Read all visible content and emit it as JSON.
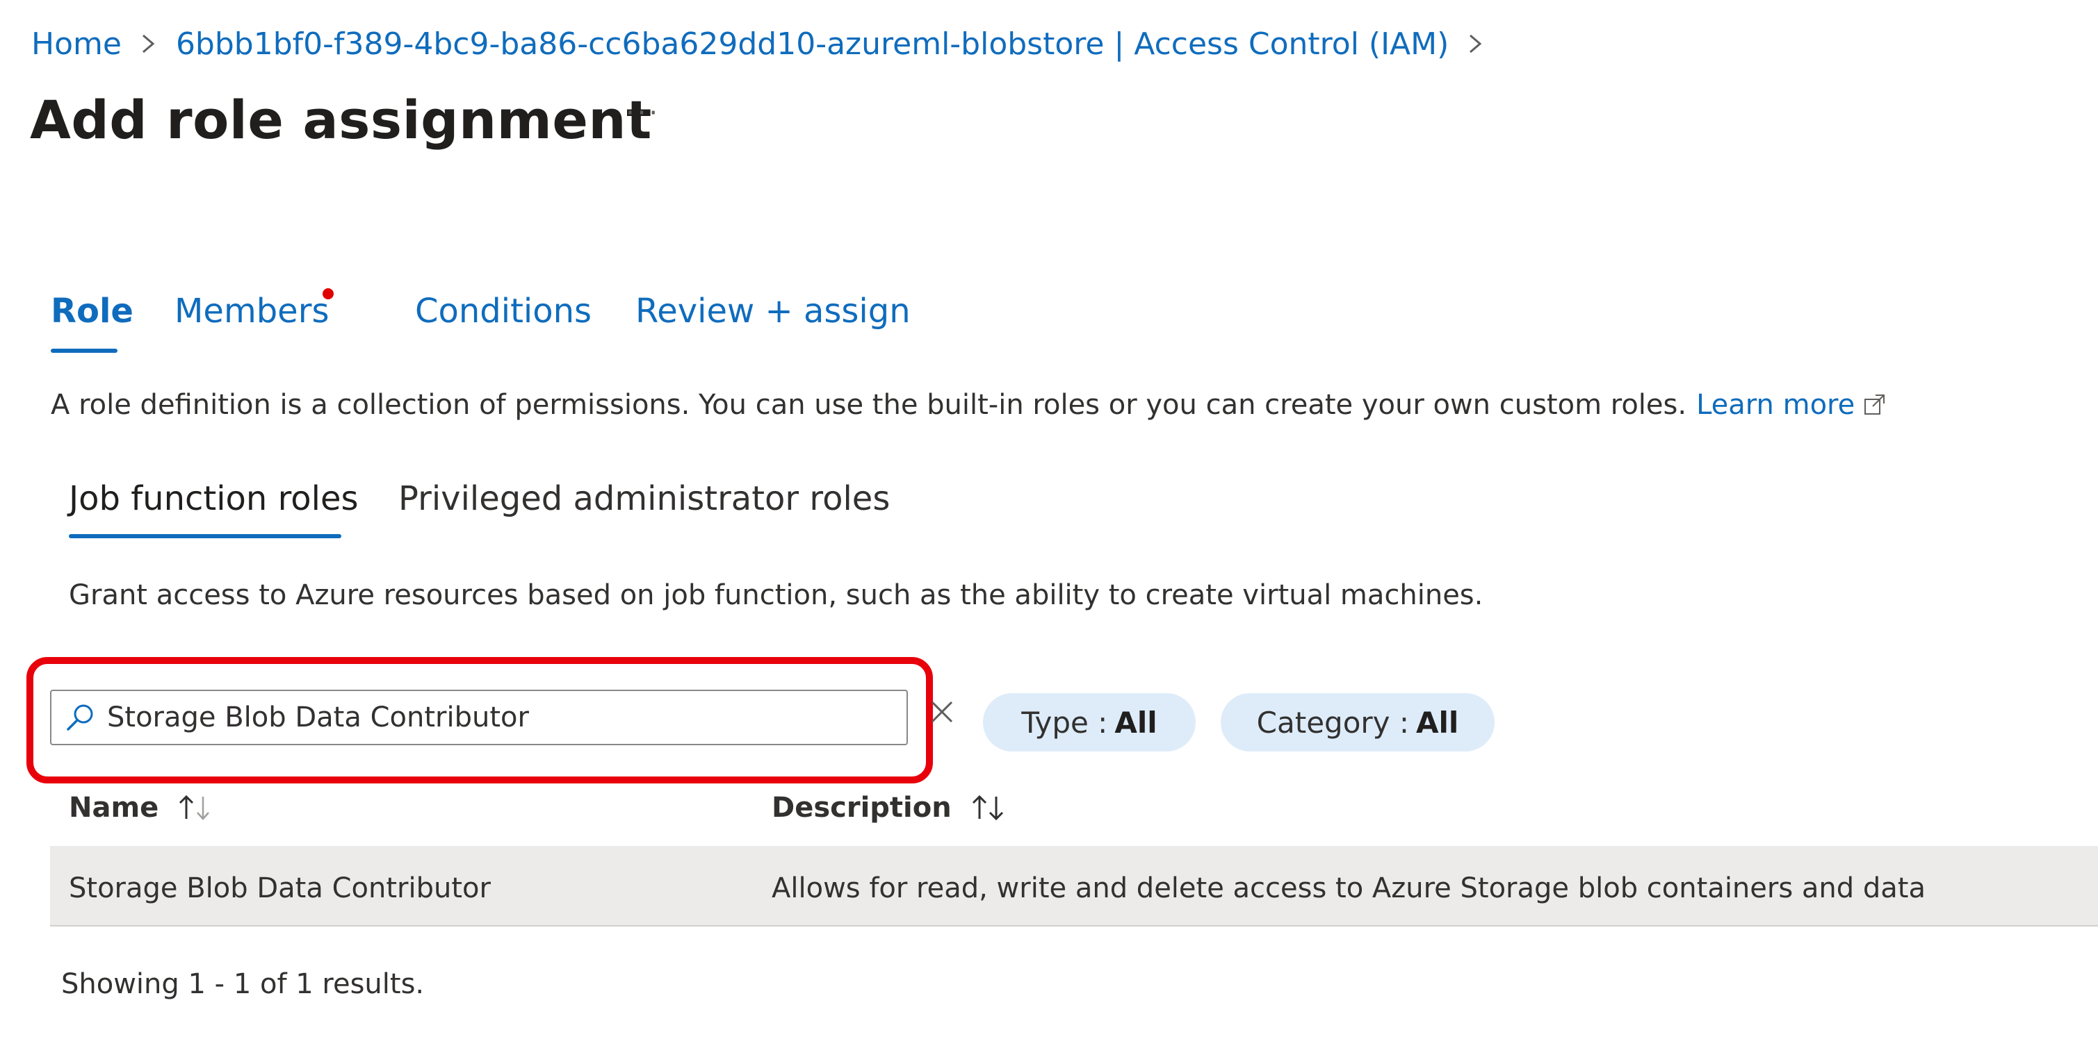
{
  "breadcrumb": {
    "home": "Home",
    "resource": "6bbb1bf0-f389-4bc9-ba86-cc6ba629dd10-azureml-blobstore | Access Control (IAM)"
  },
  "page": {
    "title": "Add role assignment",
    "more": "···"
  },
  "tabs": [
    {
      "label": "Role",
      "selected": true
    },
    {
      "label": "Members",
      "has_indicator": true
    },
    {
      "label": "Conditions"
    },
    {
      "label": "Review + assign"
    }
  ],
  "role_description": {
    "text": "A role definition is a collection of permissions. You can use the built-in roles or you can create your own custom roles.",
    "link": "Learn more"
  },
  "subtabs": [
    {
      "label": "Job function roles",
      "selected": true
    },
    {
      "label": "Privileged administrator roles"
    }
  ],
  "job_description": "Grant access to Azure resources based on job function, such as the ability to create virtual machines.",
  "search": {
    "value": "Storage Blob Data Contributor"
  },
  "filters": {
    "type": {
      "label": "Type :",
      "value": "All"
    },
    "category": {
      "label": "Category :",
      "value": "All"
    }
  },
  "table": {
    "columns": [
      "Name",
      "Description"
    ],
    "rows": [
      {
        "name": "Storage Blob Data Contributor",
        "description": "Allows for read, write and delete access to Azure Storage blob containers and data"
      }
    ]
  },
  "results_text": "Showing 1 - 1 of 1 results.",
  "colors": {
    "link": "#0f6cbd",
    "highlight": "#e8000b",
    "pill_bg": "#deecf9",
    "row_bg": "#edebe9",
    "indicator": "#e00000"
  },
  "icons": {
    "breadcrumb_separator": "chevron-right-icon",
    "search": "search-icon",
    "clear": "close-icon",
    "external": "external-link-icon",
    "sort": "sort-icon"
  }
}
